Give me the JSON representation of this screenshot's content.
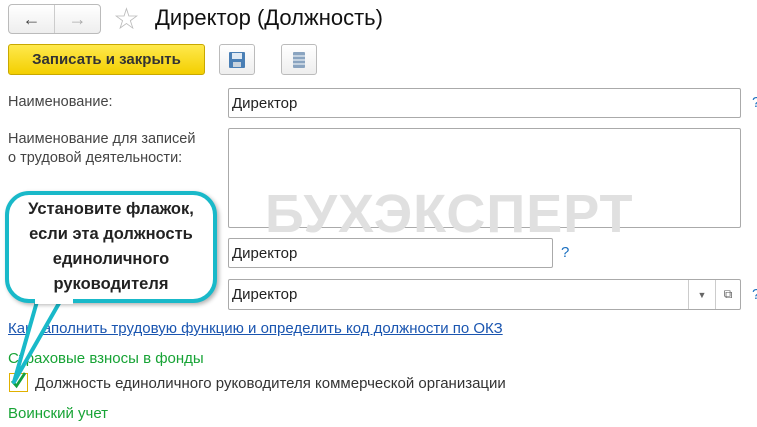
{
  "header": {
    "title": "Директор (Должность)"
  },
  "toolbar": {
    "save_close_label": "Записать и закрыть"
  },
  "form": {
    "name_label": "Наименование:",
    "name_value": "Директор",
    "labor_name_label_1": "Наименование для записей",
    "labor_name_label_2": "о трудовой деятельности:",
    "labor_name_value": "",
    "field3_value": "Директор",
    "field4_value": "Директор",
    "help": "?",
    "okz_link": "Как заполнить трудовую функцию и определить код должности по ОКЗ",
    "insurance_heading": "Страховые взносы в фонды",
    "sole_head_label": "Должность единоличного руководителя коммерческой организации",
    "sole_head_checked": true,
    "military_heading": "Воинский учет"
  },
  "callout": {
    "line1": "Установите флажок,",
    "line2": "если эта должность",
    "line3": "единоличного",
    "line4": "руководителя"
  },
  "watermark": "БУХЭКСПЕРТ",
  "colors": {
    "accent": "#f3cf00",
    "callout_border": "#19b9c9",
    "section": "#17a335",
    "link": "#1a55b0"
  }
}
